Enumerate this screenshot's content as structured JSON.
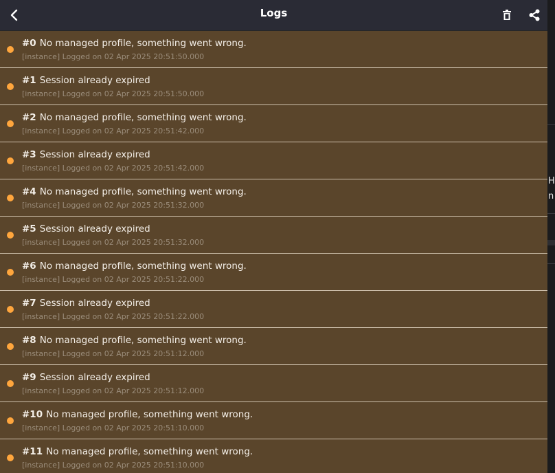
{
  "header": {
    "title": "Logs",
    "back_icon": "chevron-left-icon",
    "delete_icon": "trash-icon",
    "share_icon": "share-icon"
  },
  "colors": {
    "header_bg": "#2a2b35",
    "row_bg": "#5a452b",
    "row_divider": "#d0c2ae",
    "dot": "#ffa63d",
    "meta_text": "#9b8d7b"
  },
  "logs": [
    {
      "num": "#0",
      "message": "No managed profile, something went wrong.",
      "meta": "[instance] Logged on 02 Apr 2025 20:51:50.000"
    },
    {
      "num": "#1",
      "message": "Session already expired",
      "meta": "[instance] Logged on 02 Apr 2025 20:51:50.000"
    },
    {
      "num": "#2",
      "message": "No managed profile, something went wrong.",
      "meta": "[instance] Logged on 02 Apr 2025 20:51:42.000"
    },
    {
      "num": "#3",
      "message": "Session already expired",
      "meta": "[instance] Logged on 02 Apr 2025 20:51:42.000"
    },
    {
      "num": "#4",
      "message": "No managed profile, something went wrong.",
      "meta": "[instance] Logged on 02 Apr 2025 20:51:32.000"
    },
    {
      "num": "#5",
      "message": "Session already expired",
      "meta": "[instance] Logged on 02 Apr 2025 20:51:32.000"
    },
    {
      "num": "#6",
      "message": "No managed profile, something went wrong.",
      "meta": "[instance] Logged on 02 Apr 2025 20:51:22.000"
    },
    {
      "num": "#7",
      "message": "Session already expired",
      "meta": "[instance] Logged on 02 Apr 2025 20:51:22.000"
    },
    {
      "num": "#8",
      "message": "No managed profile, something went wrong.",
      "meta": "[instance] Logged on 02 Apr 2025 20:51:12.000"
    },
    {
      "num": "#9",
      "message": "Session already expired",
      "meta": "[instance] Logged on 02 Apr 2025 20:51:12.000"
    },
    {
      "num": "#10",
      "message": "No managed profile, something went wrong.",
      "meta": "[instance] Logged on 02 Apr 2025 20:51:10.000"
    },
    {
      "num": "#11",
      "message": "No managed profile, something went wrong.",
      "meta": "[instance] Logged on 02 Apr 2025 20:51:10.000"
    }
  ],
  "background_window": {
    "line1": "Ho",
    "line2": "n"
  }
}
